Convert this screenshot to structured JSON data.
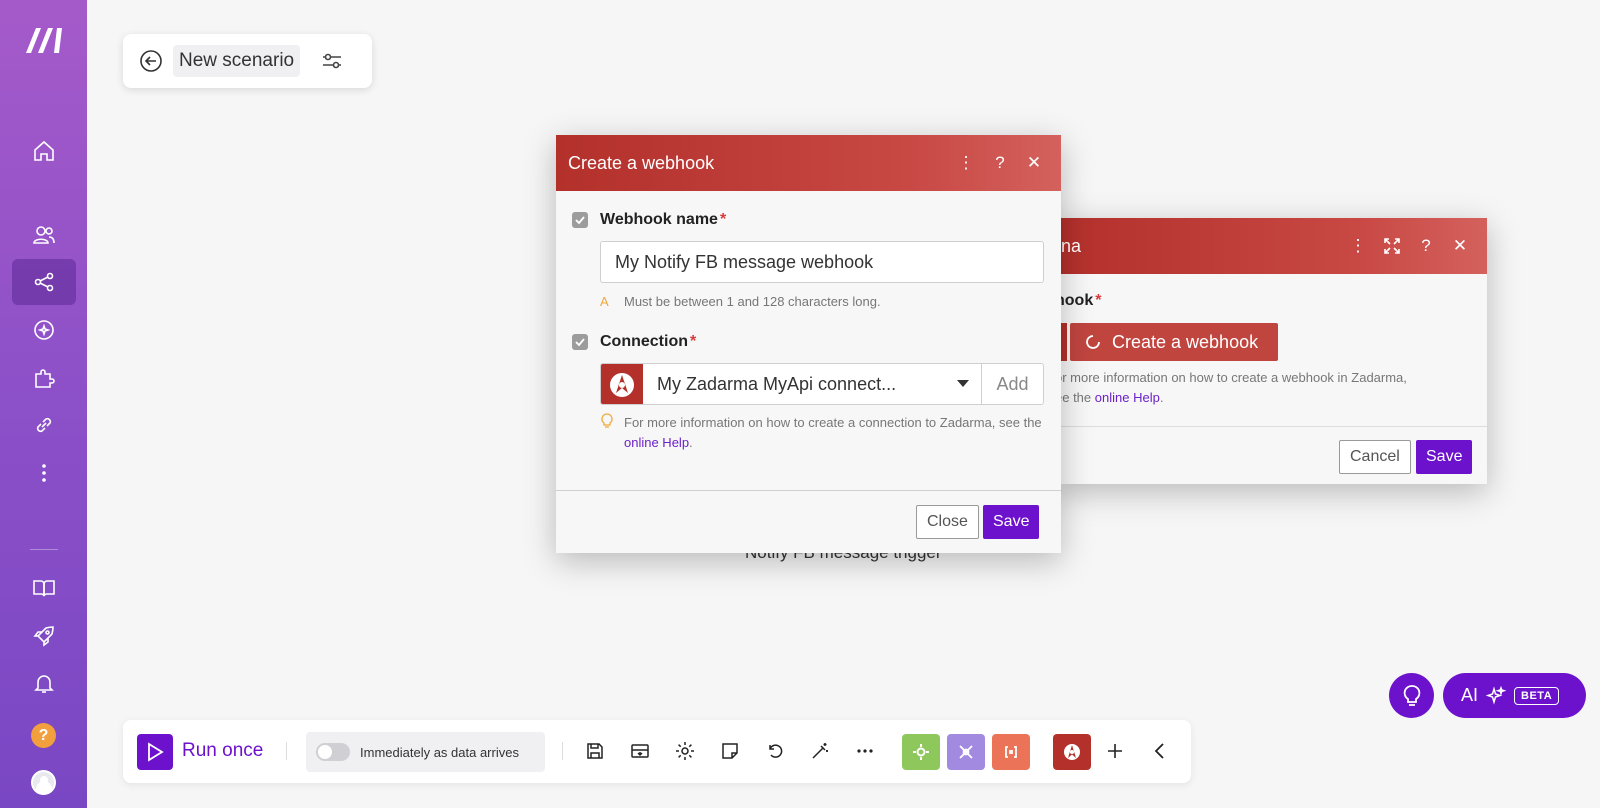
{
  "scenario": {
    "title": "New scenario"
  },
  "canvas": {
    "module_label": "Notify FB message trigger"
  },
  "webhook_dialog": {
    "title": "Create a webhook",
    "webhook_name_label": "Webhook name",
    "webhook_name_value": "My Notify FB message webhook",
    "webhook_name_hint": "Must be between 1 and 128 characters long.",
    "connection_label": "Connection",
    "connection_value": "My Zadarma MyApi connect...",
    "add_label": "Add",
    "connection_hint_prefix": "For more information on how to create a connection to Zadarma, see the",
    "help_link": "online Help",
    "hint_suffix": ".",
    "close_label": "Close",
    "save_label": "Save"
  },
  "module_dialog": {
    "title_partial": "na",
    "webhook_label_partial": "hook",
    "create_webhook_label": "Create a webhook",
    "hint_line1": "or more information on how to create a webhook in Zadarma,",
    "hint_line2": "ee the",
    "help_link": "online Help",
    "hint_suffix": ".",
    "cancel_label": "Cancel",
    "save_label": "Save"
  },
  "toolbar": {
    "run_once_label": "Run once",
    "schedule_label": "Immediately as data arrives"
  },
  "ai_button": {
    "label": "AI",
    "badge": "BETA"
  },
  "colors": {
    "accent": "#6d12cc",
    "module_red": "#b3302b",
    "sidebar_top": "#a55ac9"
  }
}
